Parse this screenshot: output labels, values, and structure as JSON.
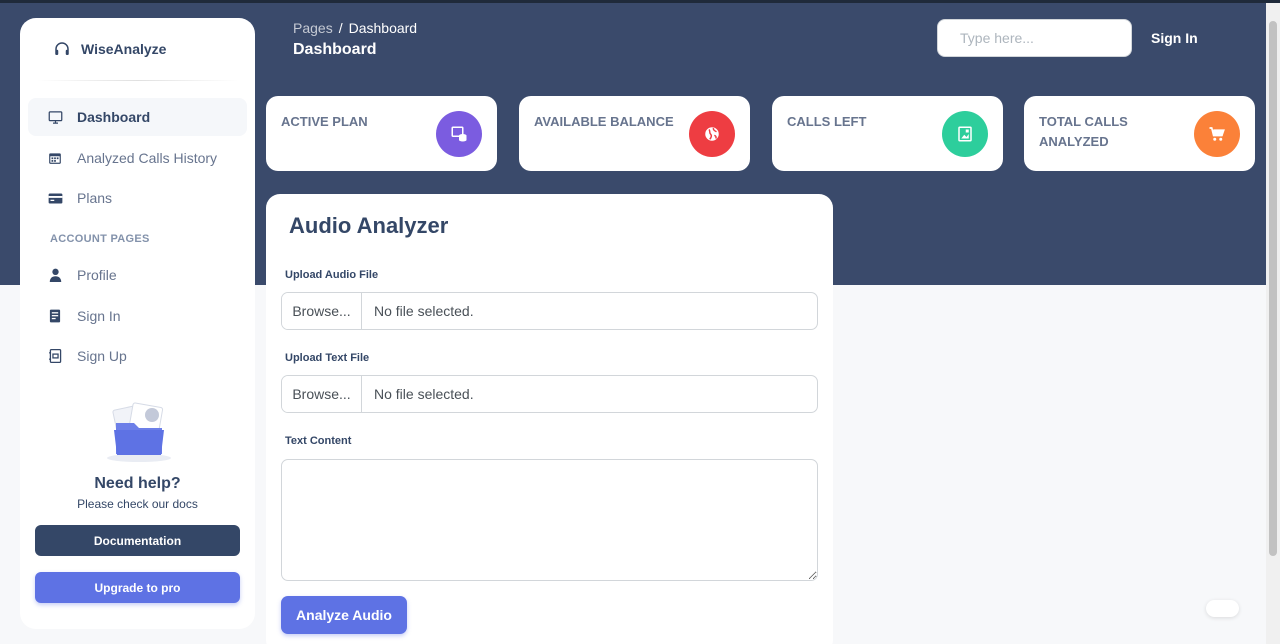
{
  "sidebar": {
    "brand": {
      "name": "WiseAnalyze",
      "icon": "headset-icon"
    },
    "nav": [
      {
        "label": "Dashboard",
        "icon": "monitor-icon",
        "active": true
      },
      {
        "label": "Analyzed Calls History",
        "icon": "calendar-icon",
        "active": false
      },
      {
        "label": "Plans",
        "icon": "credit-card-icon",
        "active": false
      }
    ],
    "section_title": "ACCOUNT PAGES",
    "account_nav": [
      {
        "label": "Profile",
        "icon": "user-icon"
      },
      {
        "label": "Sign In",
        "icon": "document-icon"
      },
      {
        "label": "Sign Up",
        "icon": "signup-icon"
      }
    ],
    "help": {
      "title": "Need help?",
      "subtitle": "Please check our docs",
      "documentation_label": "Documentation",
      "upgrade_label": "Upgrade to pro"
    }
  },
  "header": {
    "breadcrumb_root": "Pages",
    "breadcrumb_separator": "/",
    "breadcrumb_current": "Dashboard",
    "title": "Dashboard",
    "search_placeholder": "Type here...",
    "sign_in_label": "Sign In"
  },
  "stats": [
    {
      "label": "ACTIVE PLAN",
      "icon": "database-icon",
      "color": "#7b5ce0"
    },
    {
      "label": "AVAILABLE BALANCE",
      "icon": "globe-icon",
      "color": "#ee3d42"
    },
    {
      "label": "CALLS LEFT",
      "icon": "image-icon",
      "color": "#2dce9c"
    },
    {
      "label": "TOTAL CALLS ANALYZED",
      "icon": "cart-icon",
      "color": "#fb8139"
    }
  ],
  "analyzer": {
    "title": "Audio Analyzer",
    "audio_label": "Upload Audio File",
    "text_label": "Upload Text File",
    "content_label": "Text Content",
    "browse_label": "Browse...",
    "no_file": "No file selected.",
    "analyze_label": "Analyze Audio"
  },
  "colors": {
    "hero": "#3a4a6b",
    "primary": "#5e72e4",
    "dark": "#344767"
  }
}
